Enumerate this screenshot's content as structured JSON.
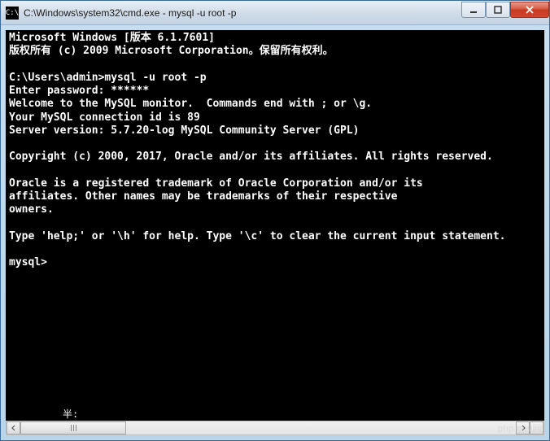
{
  "window": {
    "title": "C:\\Windows\\system32\\cmd.exe - mysql  -u root -p",
    "icon_label": "C:\\"
  },
  "terminal": {
    "lines": [
      "Microsoft Windows [版本 6.1.7601]",
      "版权所有 (c) 2009 Microsoft Corporation。保留所有权利。",
      "",
      "C:\\Users\\admin>mysql -u root -p",
      "Enter password: ******",
      "Welcome to the MySQL monitor.  Commands end with ; or \\g.",
      "Your MySQL connection id is 89",
      "Server version: 5.7.20-log MySQL Community Server (GPL)",
      "",
      "Copyright (c) 2000, 2017, Oracle and/or its affiliates. All rights reserved.",
      "",
      "Oracle is a registered trademark of Oracle Corporation and/or its",
      "affiliates. Other names may be trademarks of their respective",
      "owners.",
      "",
      "Type 'help;' or '\\h' for help. Type '\\c' to clear the current input statement.",
      "",
      "mysql>"
    ]
  },
  "status": {
    "text": "半:"
  },
  "watermark": "php m.v网"
}
